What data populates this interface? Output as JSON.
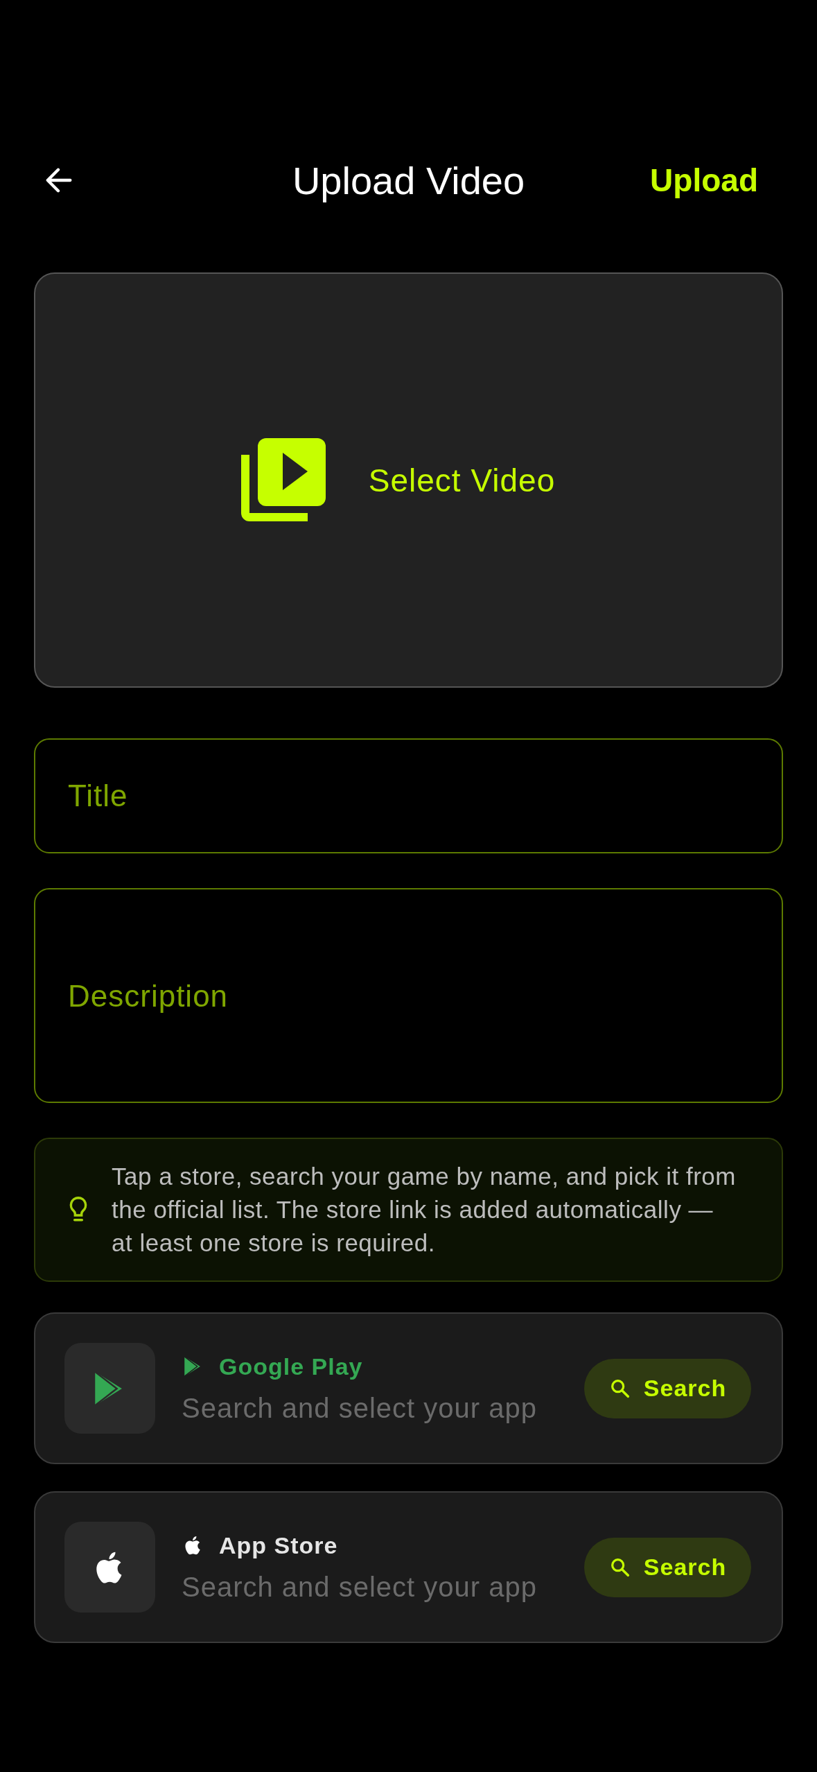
{
  "header": {
    "title": "Upload Video",
    "action": "Upload"
  },
  "video_picker": {
    "label": "Select Video"
  },
  "title_field": {
    "placeholder": "Title"
  },
  "description_field": {
    "placeholder": "Description"
  },
  "hint": {
    "text": "Tap a store, search your game by name, and pick it from the official list. The store link is added automatically — at least one store is required."
  },
  "stores": [
    {
      "kind": "google_play",
      "name": "Google Play",
      "color": "#34a853",
      "subtitle": "Search and select your app",
      "button": "Search"
    },
    {
      "kind": "app_store",
      "name": "App Store",
      "color": "#e6e6e6",
      "subtitle": "Search and select your app",
      "button": "Search"
    }
  ]
}
